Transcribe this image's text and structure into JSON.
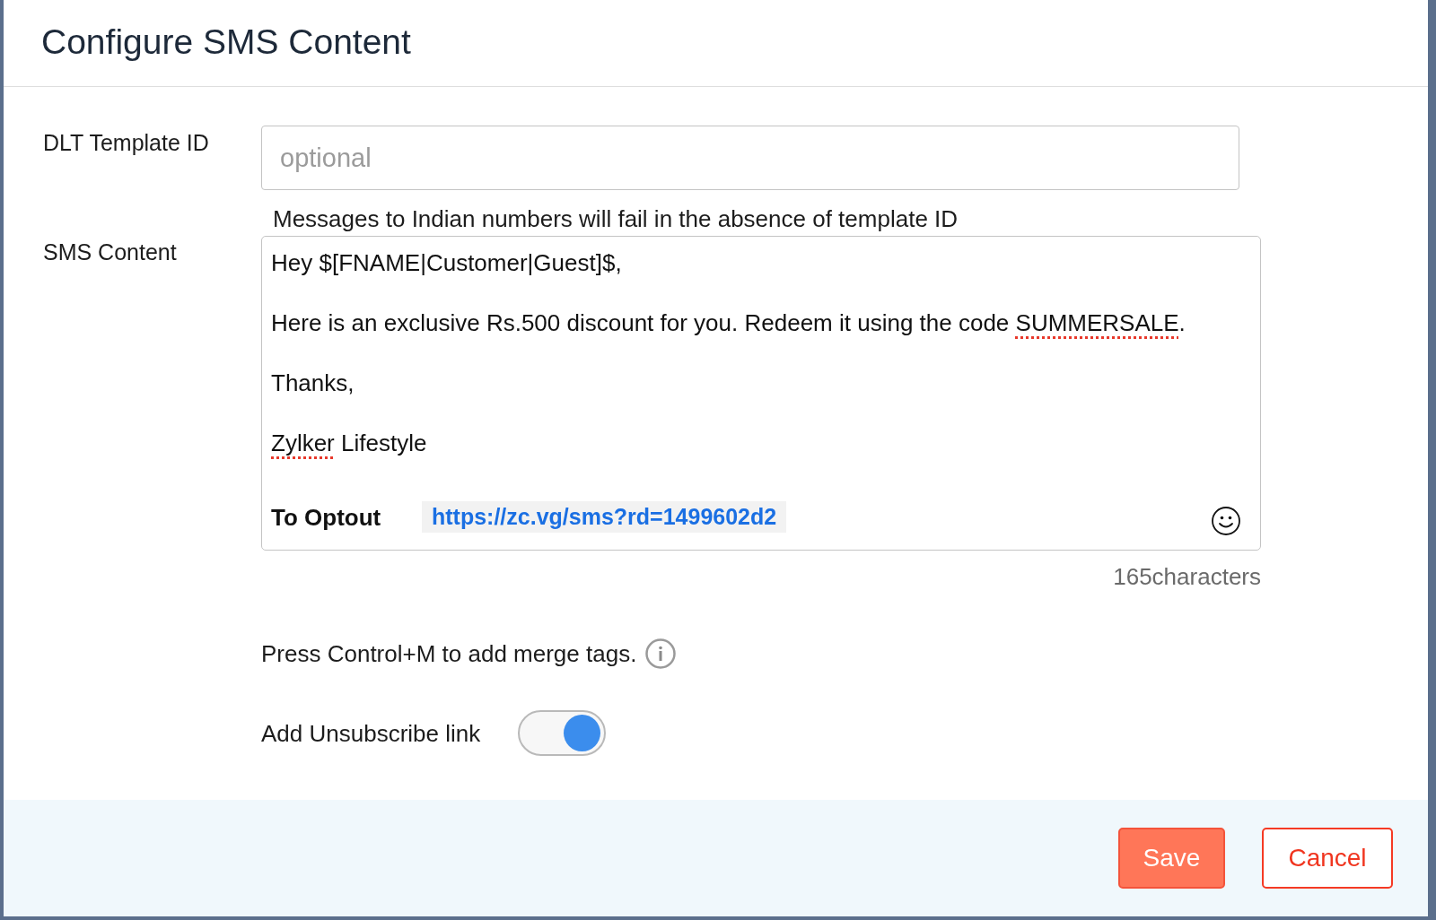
{
  "title": "Configure SMS Content",
  "template_id": {
    "label": "DLT Template ID",
    "placeholder": "optional",
    "hint": "Messages to Indian numbers will fail in the absence of template ID"
  },
  "sms_content": {
    "label": "SMS Content",
    "lines": [
      {
        "segments": [
          {
            "text": "Hey $[FNAME|Customer|Guest]$,",
            "misspelled": false
          }
        ]
      },
      {
        "segments": [
          {
            "text": "Here is an exclusive Rs.500 discount for you. Redeem it using the code ",
            "misspelled": false
          },
          {
            "text": "SUMMERSALE",
            "misspelled": true
          },
          {
            "text": ".",
            "misspelled": false
          }
        ]
      },
      {
        "segments": [
          {
            "text": "Thanks,",
            "misspelled": false
          }
        ]
      },
      {
        "segments": [
          {
            "text": "Zylker",
            "misspelled": true
          },
          {
            "text": " Lifestyle",
            "misspelled": false
          }
        ]
      }
    ],
    "optout": {
      "label": "To Optout",
      "link": "https://zc.vg/sms?rd=1499602d2"
    },
    "character_count": "165characters"
  },
  "merge_tip": "Press Control+M to add merge tags.",
  "unsubscribe": {
    "label": "Add Unsubscribe link",
    "on": true
  },
  "buttons": [
    {
      "label": "Save",
      "kind": "primary"
    },
    {
      "label": "Cancel",
      "kind": "secondary"
    }
  ]
}
